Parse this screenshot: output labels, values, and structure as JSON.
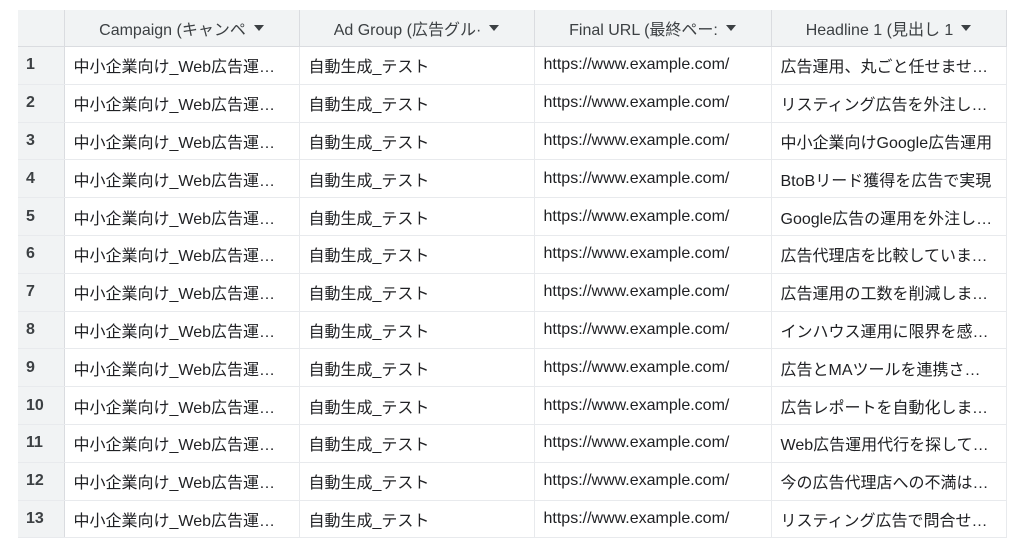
{
  "columns": [
    {
      "label": "Campaign (キャンペ"
    },
    {
      "label": "Ad Group (広告グル·"
    },
    {
      "label": "Final URL (最終ペー:"
    },
    {
      "label": "Headline 1 (見出し 1"
    }
  ],
  "rows": [
    {
      "num": "1",
      "campaign": "中小企業向け_Web広告運用代行",
      "ad_group": "自動生成_テスト",
      "final_url": "https://www.example.com/",
      "headline1": "広告運用、丸ごと任せませんか"
    },
    {
      "num": "2",
      "campaign": "中小企業向け_Web広告運用代行",
      "ad_group": "自動生成_テスト",
      "final_url": "https://www.example.com/",
      "headline1": "リスティング広告を外注しませんか"
    },
    {
      "num": "3",
      "campaign": "中小企業向け_Web広告運用代行",
      "ad_group": "自動生成_テスト",
      "final_url": "https://www.example.com/",
      "headline1": "中小企業向けGoogle広告運用"
    },
    {
      "num": "4",
      "campaign": "中小企業向け_Web広告運用代行",
      "ad_group": "自動生成_テスト",
      "final_url": "https://www.example.com/",
      "headline1": "BtoBリード獲得を広告で実現"
    },
    {
      "num": "5",
      "campaign": "中小企業向け_Web広告運用代行",
      "ad_group": "自動生成_テスト",
      "final_url": "https://www.example.com/",
      "headline1": "Google広告の運用を外注しよう"
    },
    {
      "num": "6",
      "campaign": "中小企業向け_Web広告運用代行",
      "ad_group": "自動生成_テスト",
      "final_url": "https://www.example.com/",
      "headline1": "広告代理店を比較していませんか"
    },
    {
      "num": "7",
      "campaign": "中小企業向け_Web広告運用代行",
      "ad_group": "自動生成_テスト",
      "final_url": "https://www.example.com/",
      "headline1": "広告運用の工数を削減しませんか"
    },
    {
      "num": "8",
      "campaign": "中小企業向け_Web広告運用代行",
      "ad_group": "自動生成_テスト",
      "final_url": "https://www.example.com/",
      "headline1": "インハウス運用に限界を感じたら"
    },
    {
      "num": "9",
      "campaign": "中小企業向け_Web広告運用代行",
      "ad_group": "自動生成_テスト",
      "final_url": "https://www.example.com/",
      "headline1": "広告とMAツールを連携させよう"
    },
    {
      "num": "10",
      "campaign": "中小企業向け_Web広告運用代行",
      "ad_group": "自動生成_テスト",
      "final_url": "https://www.example.com/",
      "headline1": "広告レポートを自動化しませんか"
    },
    {
      "num": "11",
      "campaign": "中小企業向け_Web広告運用代行",
      "ad_group": "自動生成_テスト",
      "final_url": "https://www.example.com/",
      "headline1": "Web広告運用代行を探しているなら"
    },
    {
      "num": "12",
      "campaign": "中小企業向け_Web広告運用代行",
      "ad_group": "自動生成_テスト",
      "final_url": "https://www.example.com/",
      "headline1": "今の広告代理店への不満はありませんか"
    },
    {
      "num": "13",
      "campaign": "中小企業向け_Web広告運用代行",
      "ad_group": "自動生成_テスト",
      "final_url": "https://www.example.com/",
      "headline1": "リスティング広告で問合せ増加"
    }
  ]
}
